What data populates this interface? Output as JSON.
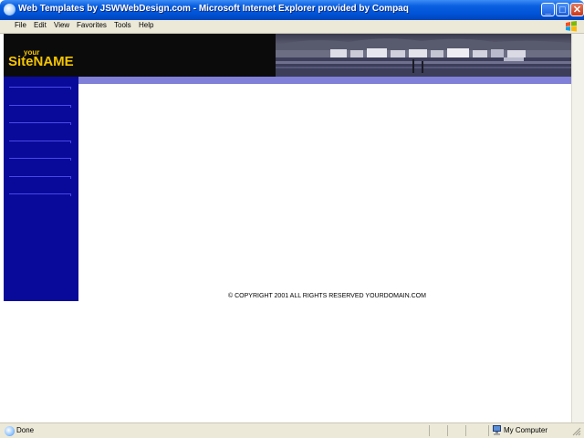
{
  "window": {
    "title": "Web Templates by JSWWebDesign.com - Microsoft Internet Explorer provided by Compaq",
    "buttons": {
      "minimize": "_",
      "maximize": "□",
      "close": "✕"
    }
  },
  "menu": {
    "file": "File",
    "edit": "Edit",
    "view": "View",
    "favorites": "Favorites",
    "tools": "Tools",
    "help": "Help"
  },
  "page": {
    "logo_small": "your",
    "logo_main": "SiteNAME",
    "copyright": "© COPYRIGHT 2001 ALL RIGHTS RESERVED YOURDOMAIN.COM",
    "sidebar_link_count": 7
  },
  "status": {
    "text": "Done",
    "zone": "My Computer"
  },
  "icons": {
    "title": "ie-icon",
    "menu_right": "windows-logo-icon",
    "status": "ie-page-icon",
    "zone": "computer-icon"
  },
  "colors": {
    "titlebar": "#0052d6",
    "sidebar": "#0a0a9a",
    "stripe": "#8080d8",
    "logo": "#f5c400",
    "banner": "#0b0b0b"
  }
}
